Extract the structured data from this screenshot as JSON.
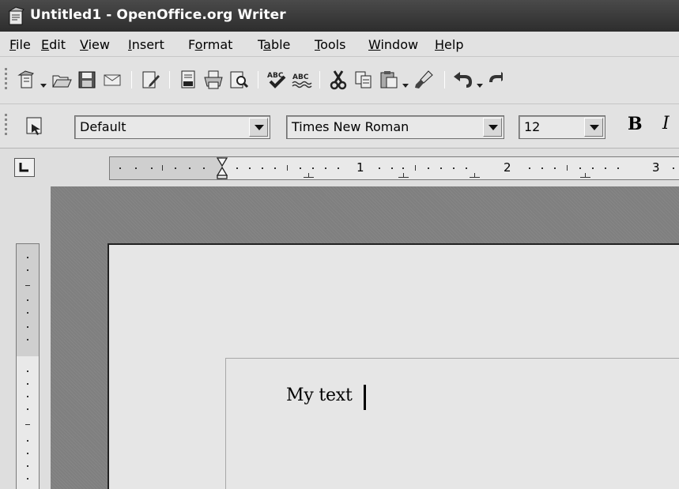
{
  "window": {
    "title": "Untitled1 - OpenOffice.org Writer",
    "icon": "writer-app-icon"
  },
  "menu": {
    "items": [
      {
        "label": "File",
        "accel": "F",
        "rest": "ile"
      },
      {
        "label": "Edit",
        "accel": "E",
        "rest": "dit"
      },
      {
        "label": "View",
        "accel": "V",
        "rest": "iew"
      },
      {
        "label": "Insert",
        "accel": "I",
        "rest": "nsert"
      },
      {
        "label": "Format",
        "pre": "F",
        "accel": "o",
        "rest": "rmat"
      },
      {
        "label": "Table",
        "pre": "T",
        "accel": "a",
        "rest": "ble"
      },
      {
        "label": "Tools",
        "accel": "T",
        "rest": "ools"
      },
      {
        "label": "Window",
        "accel": "W",
        "rest": "indow"
      },
      {
        "label": "Help",
        "accel": "H",
        "rest": "elp"
      }
    ]
  },
  "standard_toolbar": {
    "icons": [
      "new-icon",
      "open-icon",
      "save-icon",
      "email-icon",
      "edit-file-icon",
      "export-pdf-icon",
      "print-icon",
      "page-preview-icon",
      "spellcheck-icon",
      "autospellcheck-icon",
      "cut-icon",
      "copy-icon",
      "paste-icon",
      "format-paintbrush-icon",
      "undo-icon"
    ]
  },
  "formatting_toolbar": {
    "paragraph_style": "Default",
    "font_name": "Times New Roman",
    "font_size": "12",
    "bold_label": "B",
    "italic_label": "I"
  },
  "ruler": {
    "numbers": [
      "1",
      "2",
      "3"
    ]
  },
  "document": {
    "text": "My text"
  }
}
